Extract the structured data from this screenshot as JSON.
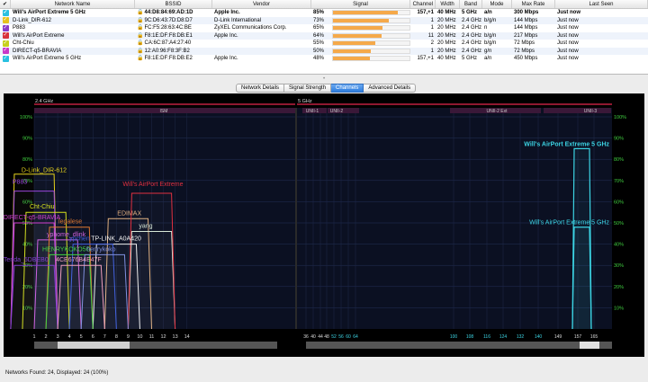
{
  "table": {
    "headers": [
      "✔",
      "Network Name",
      "BSSID",
      "Vendor",
      "Signal",
      "Channel",
      "Width",
      "Band",
      "Mode",
      "Max Rate",
      "Last Seen"
    ],
    "rows": [
      {
        "name": "Will's AirPort Extreme 5 GHz",
        "bssid": "44:D8:84:69:AD:1D",
        "vendor": "Apple Inc.",
        "signal": "85%",
        "signal_value": 85,
        "channel": "157,+1",
        "width": "40 MHz",
        "band": "5 GHz",
        "mode": "a/n",
        "rate": "300 Mbps",
        "seen": "Just now",
        "color": "#29c0e0",
        "selected": true
      },
      {
        "name": "D-Link_DIR-612",
        "bssid": "9C:D6:43:7D:D8:D7",
        "vendor": "D-Link International",
        "signal": "73%",
        "signal_value": 73,
        "channel": "1",
        "width": "20 MHz",
        "band": "2.4 GHz",
        "mode": "b/g/n",
        "rate": "144 Mbps",
        "seen": "Just now",
        "color": "#e6c21c",
        "selected": false
      },
      {
        "name": "P883",
        "bssid": "FC:F5:28:63:4C:BE",
        "vendor": "ZyXEL Communications Corp.",
        "signal": "65%",
        "signal_value": 65,
        "channel": "1",
        "width": "20 MHz",
        "band": "2.4 GHz",
        "mode": "n",
        "rate": "144 Mbps",
        "seen": "Just now",
        "color": "#8a3cc8",
        "selected": false
      },
      {
        "name": "Will's AirPort Extreme",
        "bssid": "F8:1E:DF:F8:DB:E1",
        "vendor": "Apple Inc.",
        "signal": "64%",
        "signal_value": 64,
        "channel": "11",
        "width": "20 MHz",
        "band": "2.4 GHz",
        "mode": "b/g/n",
        "rate": "217 Mbps",
        "seen": "Just now",
        "color": "#d8303a",
        "selected": false
      },
      {
        "name": "Cht-Chiu",
        "bssid": "CA:6C:87:A4:27:40",
        "vendor": "",
        "signal": "55%",
        "signal_value": 55,
        "channel": "2",
        "width": "20 MHz",
        "band": "2.4 GHz",
        "mode": "b/g/n",
        "rate": "72 Mbps",
        "seen": "Just now",
        "color": "#c6d01c",
        "selected": false
      },
      {
        "name": "DIRECT-q5-BRAVIA",
        "bssid": "12:A0:96:F8:3F:B2",
        "vendor": "",
        "signal": "50%",
        "signal_value": 50,
        "channel": "1",
        "width": "20 MHz",
        "band": "2.4 GHz",
        "mode": "g/n",
        "rate": "72 Mbps",
        "seen": "Just now",
        "color": "#c838c8",
        "selected": false
      },
      {
        "name": "Will's AirPort Extreme 5 GHz",
        "bssid": "F8:1E:DF:F8:DB:E2",
        "vendor": "Apple Inc.",
        "signal": "48%",
        "signal_value": 48,
        "channel": "157,+1",
        "width": "40 MHz",
        "band": "5 GHz",
        "mode": "a/n",
        "rate": "450 Mbps",
        "seen": "Just now",
        "color": "#29c0e0",
        "selected": false
      }
    ]
  },
  "splitter": "•",
  "tabs": [
    {
      "label": "Network Details",
      "active": false
    },
    {
      "label": "Signal Strength",
      "active": false
    },
    {
      "label": "Channels",
      "active": true
    },
    {
      "label": "Advanced Details",
      "active": false
    }
  ],
  "chart": {
    "band24_label": "2.4 GHz",
    "band5_label": "5 GHz",
    "ism_label": "ISM",
    "unii_labels": [
      "UNII-1",
      "UNII-2",
      "UNII-2 Ext",
      "UNII-3"
    ],
    "y_ticks": [
      "100%",
      "90%",
      "80%",
      "70%",
      "60%",
      "50%",
      "40%",
      "30%",
      "20%",
      "10%"
    ],
    "x24_ticks": [
      "1",
      "2",
      "3",
      "4",
      "5",
      "6",
      "7",
      "8",
      "9",
      "10",
      "11",
      "12",
      "13",
      "14"
    ],
    "x5_ticks": [
      "36",
      "40",
      "44",
      "48",
      "52",
      "56",
      "60",
      "64",
      "100",
      "108",
      "116",
      "124",
      "132",
      "140",
      "149",
      "157",
      "165"
    ]
  },
  "chart_data": {
    "type": "area",
    "ylim": [
      0,
      100
    ],
    "series": [
      {
        "name": "D-Link_DIR-612",
        "channels": [
          1
        ],
        "value": 73,
        "color": "#e6d21c"
      },
      {
        "name": "P883",
        "channels": [
          1
        ],
        "value": 65,
        "color": "#9a46dc"
      },
      {
        "name": "Cht-Chiu",
        "channels": [
          2
        ],
        "value": 55,
        "color": "#d4e01c"
      },
      {
        "name": "DIRECT-q5-BRAVIA",
        "channels": [
          1
        ],
        "value": 50,
        "color": "#d040d0"
      },
      {
        "name": "yphome_dlink",
        "channels": [
          3
        ],
        "value": 42,
        "color": "#d060e0"
      },
      {
        "name": "legalese",
        "channels": [
          4
        ],
        "value": 48,
        "color": "#e07830"
      },
      {
        "name": "EDIMAX",
        "channels": [
          9
        ],
        "value": 52,
        "color": "#e0b080"
      },
      {
        "name": "yang",
        "channels": [
          11
        ],
        "value": 46,
        "color": "#d8e8d8"
      },
      {
        "name": "Will's AirPort Extreme",
        "channels": [
          11
        ],
        "value": 64,
        "color": "#e03040"
      },
      {
        "name": "TP-LINK_A0A420",
        "channels": [
          8
        ],
        "value": 40,
        "color": "#f0f0f0"
      },
      {
        "name": "ypchen",
        "channels": [
          6
        ],
        "value": 40,
        "color": "#4060e0"
      },
      {
        "name": "HENRYKOKO5G",
        "channels": [
          4
        ],
        "value": 35,
        "color": "#40d040"
      },
      {
        "name": "henrykoko",
        "channels": [
          7
        ],
        "value": 35,
        "color": "#8090e0"
      },
      {
        "name": "Tenda_5DBEB0",
        "channels": [
          1
        ],
        "value": 30,
        "color": "#8040d0"
      },
      {
        "name": "4CE676B4E47F",
        "channels": [
          5
        ],
        "value": 30,
        "color": "#f0a0c0"
      },
      {
        "name": "Will's AirPort Extreme 5 GHz",
        "channels": [
          157,
          161
        ],
        "value": 85,
        "color": "#3cd4e4"
      },
      {
        "name": "Will's AirPort Extreme 5 GHz",
        "channels": [
          157,
          161
        ],
        "value": 48,
        "color": "#3cd4e4"
      }
    ]
  },
  "status": "Networks Found: 24, Displayed: 24 (100%)"
}
